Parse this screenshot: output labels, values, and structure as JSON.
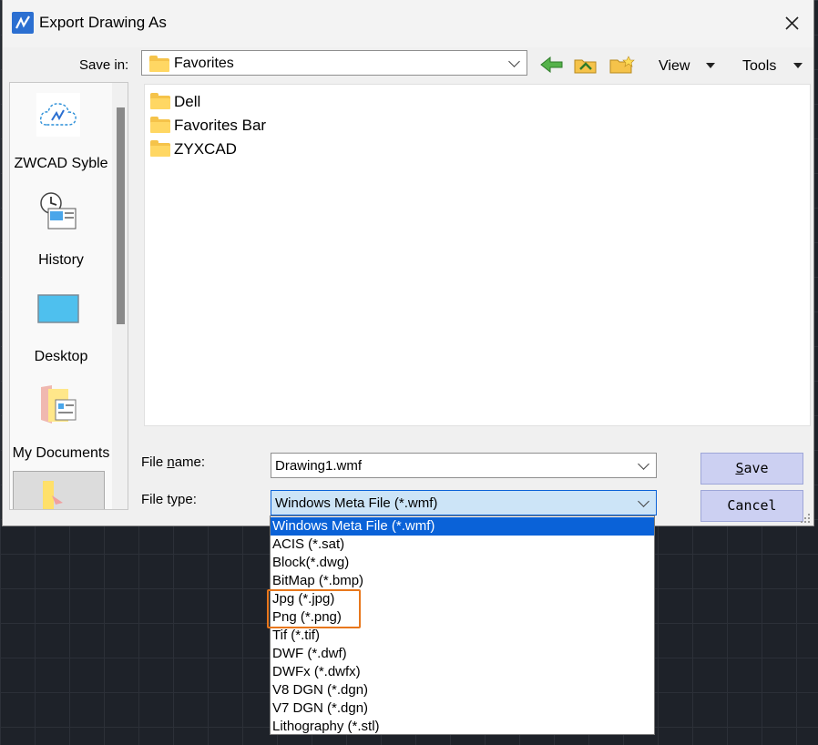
{
  "window": {
    "title": "Export Drawing As"
  },
  "save_in": {
    "label": "Save in:",
    "value": "Favorites"
  },
  "toolbar": {
    "view_label": "View",
    "tools_label": "Tools"
  },
  "places": [
    {
      "label": "ZWCAD Syble"
    },
    {
      "label": "History"
    },
    {
      "label": "Desktop"
    },
    {
      "label": "My Documents"
    }
  ],
  "files": [
    {
      "name": "Dell"
    },
    {
      "name": "Favorites Bar"
    },
    {
      "name": "ZYXCAD"
    }
  ],
  "file_name": {
    "label_prefix": "File ",
    "label_underline": "n",
    "label_suffix": "ame:",
    "value": "Drawing1.wmf"
  },
  "file_type": {
    "label": "File type:",
    "value": "Windows Meta File (*.wmf)"
  },
  "buttons": {
    "save_underline": "S",
    "save_rest": "ave",
    "cancel": "Cancel"
  },
  "file_type_options": [
    "Windows Meta File (*.wmf)",
    "ACIS (*.sat)",
    "Block(*.dwg)",
    "BitMap (*.bmp)",
    "Jpg (*.jpg)",
    "Png (*.png)",
    "Tif (*.tif)",
    "DWF (*.dwf)",
    "DWFx (*.dwfx)",
    "V8 DGN (*.dgn)",
    "V7 DGN (*.dgn)",
    "Lithography (*.stl)"
  ],
  "colors": {
    "selection": "#0a62d8",
    "highlight_box": "#e8771c",
    "button_bg": "#ccd0f2"
  }
}
